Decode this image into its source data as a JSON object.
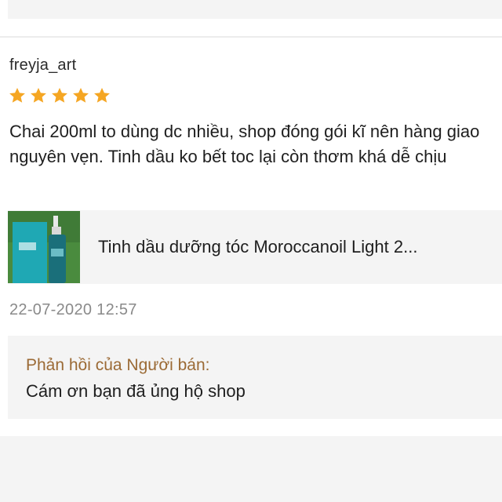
{
  "review": {
    "username": "freyja_art",
    "rating": 5,
    "rating_max": 5,
    "star_color": "#f5a623",
    "comment": "Chai 200ml to dùng dc nhiều, shop đóng gói kĩ nên hàng giao nguyên vẹn. Tinh dầu ko bết toc lại còn thơm khá dễ chịu",
    "product": {
      "name": "Tinh dầu dưỡng tóc Moroccanoil Light 2...",
      "thumbnail_icon": "product-bottle-image"
    },
    "timestamp": "22-07-2020 12:57",
    "seller_reply": {
      "title": "Phản hồi của Người bán:",
      "title_color": "#9b6a35",
      "text": "Cám ơn bạn đã ủng hộ shop"
    }
  }
}
